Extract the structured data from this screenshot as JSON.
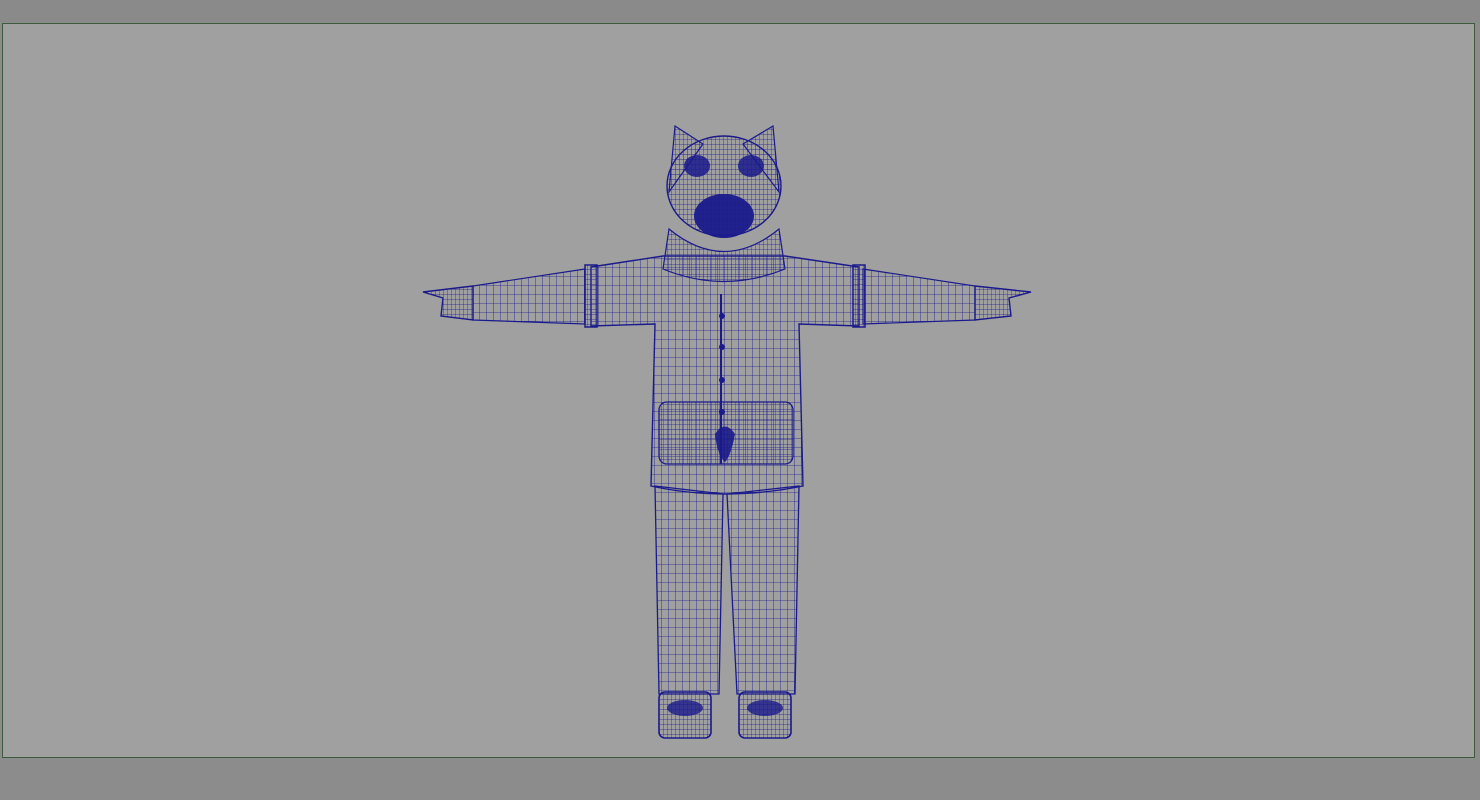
{
  "app": {
    "view": "front-orthographic",
    "display_mode": "wireframe"
  },
  "colors": {
    "viewport_background": "#a0a0a0",
    "outer_background": "#8c8c8c",
    "viewport_border": "#3d5a3d",
    "wireframe": "#1a1a8c"
  },
  "viewport": {
    "axis_hint": "ˈ"
  },
  "model": {
    "kind": "character-mesh",
    "pose": "t-pose",
    "description_parts": [
      "head",
      "ears",
      "eyes",
      "muzzle",
      "hood",
      "jacket",
      "sleeves",
      "hands",
      "pocket",
      "buttons",
      "pants",
      "shoes"
    ]
  }
}
